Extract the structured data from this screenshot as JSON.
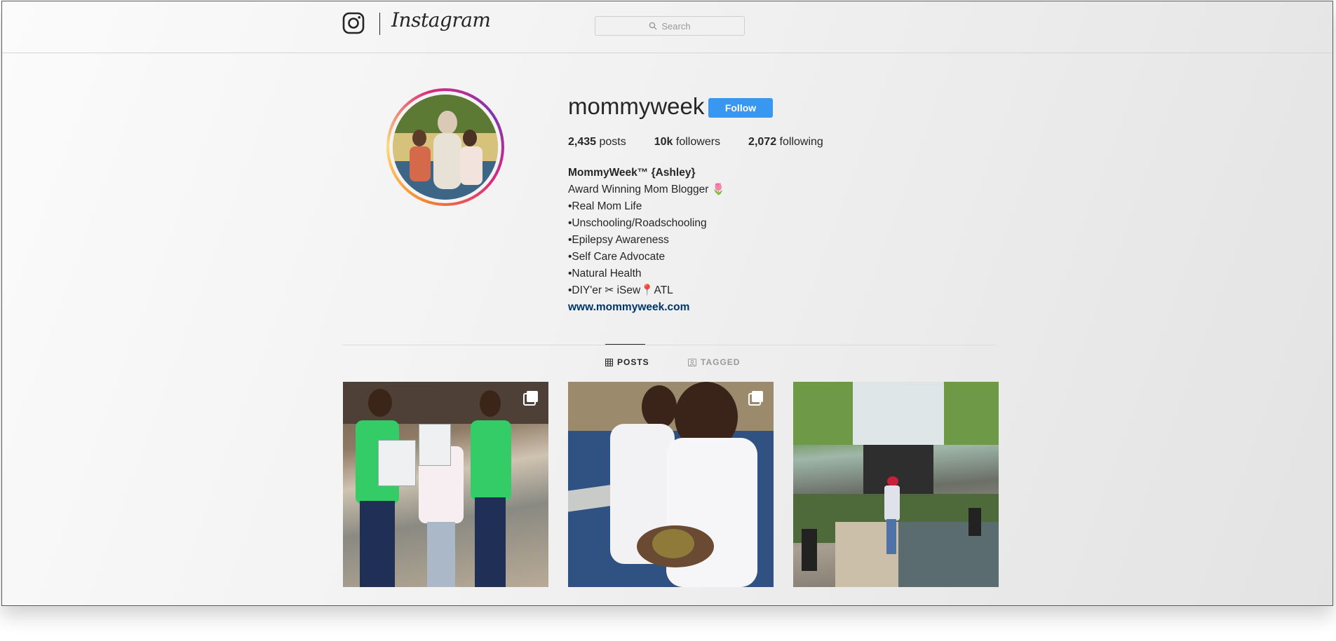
{
  "header": {
    "wordmark": "Instagram",
    "search_placeholder": "Search"
  },
  "profile": {
    "username": "mommyweek",
    "follow_label": "Follow",
    "stats": {
      "posts_count": "2,435",
      "posts_label": "posts",
      "followers_count": "10k",
      "followers_label": "followers",
      "following_count": "2,072",
      "following_label": "following"
    },
    "bio": {
      "name": "MommyWeek™ {Ashley}",
      "lines": [
        "Award Winning Mom Blogger 🌷",
        "•Real Mom Life",
        "•Unschooling/Roadschooling",
        "•Epilepsy Awareness",
        "•Self Care Advocate",
        "•Natural Health",
        "•DIY'er ✂ iSew📍ATL"
      ],
      "link": "www.mommyweek.com"
    }
  },
  "tabs": {
    "posts": "POSTS",
    "tagged": "TAGGED"
  },
  "colors": {
    "follow_button": "#3897f0",
    "link": "#003569"
  },
  "icons": {
    "logo": "instagram-camera-icon",
    "search": "search-icon",
    "posts_tab": "grid-icon",
    "tagged_tab": "tagged-icon",
    "carousel": "multiple-posts-icon"
  }
}
